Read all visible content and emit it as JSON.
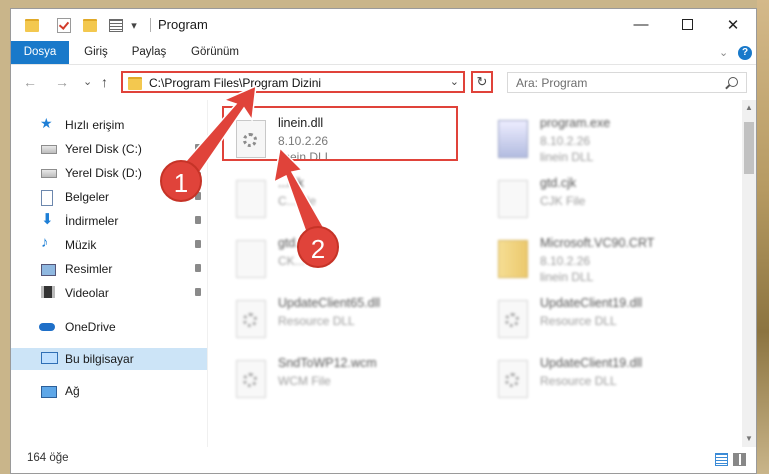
{
  "window": {
    "title": "Program",
    "minimize_glyph": "—",
    "close_glyph": "✕",
    "quick_access_dropdown": "▾"
  },
  "ribbon": {
    "tabs": [
      "Dosya",
      "Giriş",
      "Paylaş",
      "Görünüm"
    ],
    "expand_glyph": "⌄",
    "help_glyph": "?"
  },
  "navigation": {
    "back_glyph": "←",
    "forward_glyph": "→",
    "recent_glyph": "⌄",
    "up_glyph": "↑",
    "address_path": "C:\\Program Files\\Program Dizini",
    "address_dropdown_glyph": "⌄",
    "refresh_glyph": "↻",
    "search_placeholder": "Ara: Program"
  },
  "sidebar": {
    "items": [
      {
        "label": "Hızlı erişim",
        "icon": "star-icon"
      },
      {
        "label": "Yerel Disk (C:)",
        "icon": "disk-icon"
      },
      {
        "label": "Yerel Disk (D:)",
        "icon": "disk-icon"
      },
      {
        "label": "Belgeler",
        "icon": "documents-icon"
      },
      {
        "label": "İndirmeler",
        "icon": "download-icon"
      },
      {
        "label": "Müzik",
        "icon": "music-icon"
      },
      {
        "label": "Resimler",
        "icon": "pictures-icon"
      },
      {
        "label": "Videolar",
        "icon": "videos-icon"
      },
      {
        "label": "OneDrive",
        "icon": "cloud-icon"
      },
      {
        "label": "Bu bilgisayar",
        "icon": "computer-icon"
      },
      {
        "label": "Ağ",
        "icon": "network-icon"
      }
    ]
  },
  "files": [
    {
      "name": "linein.dll",
      "line2": "8.10.2.26",
      "line3": "linein DLL",
      "icon": "dll-file-icon"
    },
    {
      "name": "program.exe",
      "line2": "8.10.2.26",
      "line3": "linein DLL",
      "icon": "exe-file-icon"
    },
    {
      "name": "...cjk",
      "line2": "C...File",
      "line3": "",
      "icon": "file-icon"
    },
    {
      "name": "gtd.cjk",
      "line2": "CJK File",
      "line3": "",
      "icon": "file-icon"
    },
    {
      "name": "gtd...",
      "line2": "CK...",
      "line3": "",
      "icon": "file-icon"
    },
    {
      "name": "Microsoft.VC90.CRT",
      "line2": "8.10.2.26",
      "line3": "linein DLL",
      "icon": "zip-folder-icon"
    },
    {
      "name": "UpdateClient65.dll",
      "line2": "Resource DLL",
      "line3": "",
      "icon": "dll-file-icon"
    },
    {
      "name": "UpdateClient19.dll",
      "line2": "Resource DLL",
      "line3": "",
      "icon": "dll-file-icon"
    },
    {
      "name": "SndToWP12.wcm",
      "line2": "WCM File",
      "line3": "",
      "icon": "dll-file-icon"
    },
    {
      "name": "UpdateClient19.dll",
      "line2": "Resource DLL",
      "line3": "",
      "icon": "dll-file-icon"
    }
  ],
  "status": {
    "item_count": "164 öğe"
  },
  "callouts": [
    "1",
    "2"
  ],
  "colors": {
    "accent": "#1979ca",
    "annotation_red": "#e0433a",
    "selected_bg": "#cce4f7"
  }
}
